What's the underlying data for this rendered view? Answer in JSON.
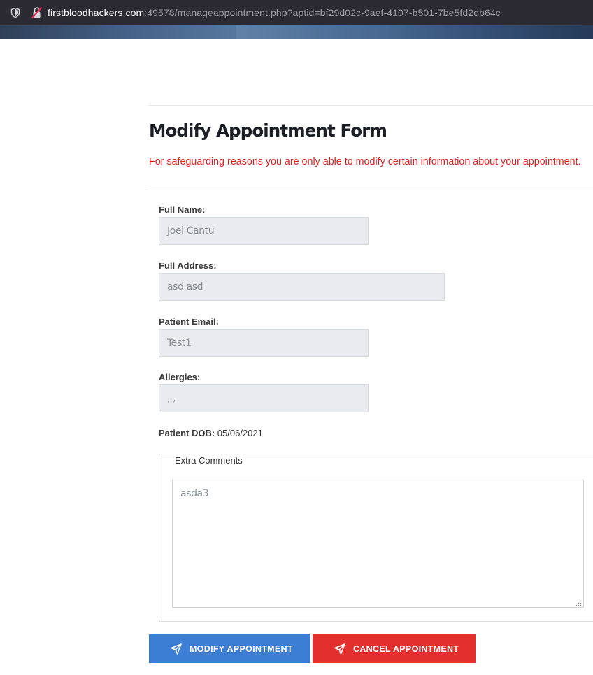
{
  "browser": {
    "url_host": "firstbloodhackers.com",
    "url_rest": ":49578/manageappointment.php?aptid=bf29d02c-9aef-4107-b501-7be5fd2db64c"
  },
  "form": {
    "title": "Modify Appointment Form",
    "notice": "For safeguarding reasons you are only able to modify certain information about your appointment.",
    "fields": {
      "full_name": {
        "label": "Full Name:",
        "value": "Joel Cantu"
      },
      "full_address": {
        "label": "Full Address:",
        "value": "asd asd"
      },
      "patient_email": {
        "label": "Patient Email:",
        "value": "Test1"
      },
      "allergies": {
        "label": "Allergies:",
        "value": ", ,"
      }
    },
    "dob": {
      "label": "Patient DOB:",
      "value": "05/06/2021"
    },
    "comments": {
      "legend": "Extra Comments",
      "value": "asda3"
    },
    "buttons": {
      "modify": "MODIFY APPOINTMENT",
      "cancel": "CANCEL APPOINTMENT"
    }
  },
  "colors": {
    "notice": "#e01e1e",
    "modify_button": "#3b7ed4",
    "cancel_button": "#e3302f"
  },
  "icons": [
    "shield-icon",
    "insecure-lock-icon",
    "send-icon",
    "resize-grip-icon"
  ]
}
